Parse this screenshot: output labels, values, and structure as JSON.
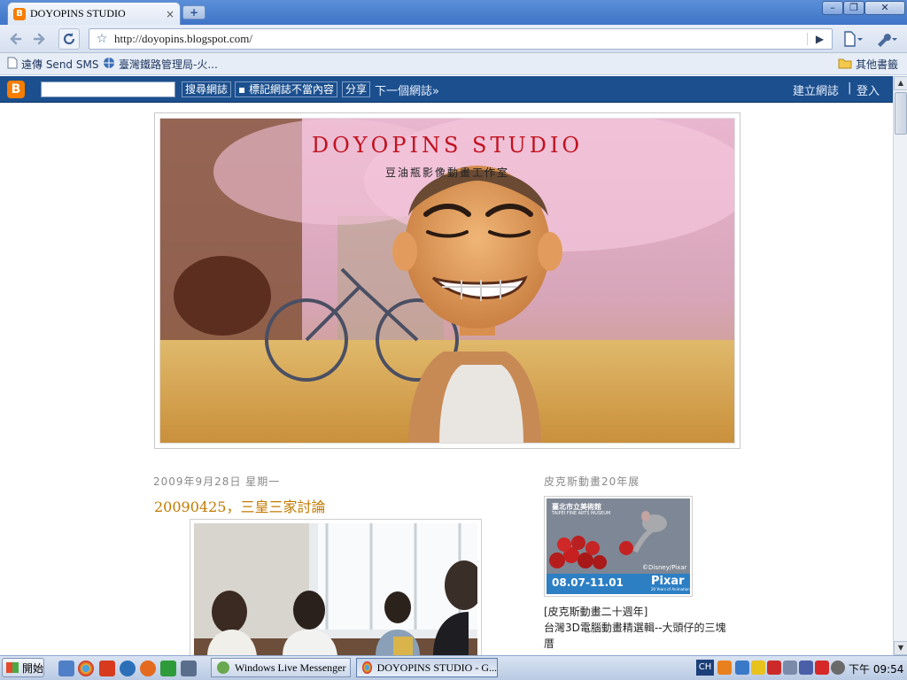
{
  "browser": {
    "tab_title": "DOYOPINS STUDIO",
    "tab_close": "×",
    "new_tab": "+",
    "url": "http://doyopins.blogspot.com/",
    "window_controls": {
      "minimize": "–",
      "restore": "❐",
      "close": "✕"
    }
  },
  "bookmarks": {
    "items": [
      {
        "label": "遠傳 Send SMS",
        "icon": "page-icon"
      },
      {
        "label": "臺灣鐵路管理局-火...",
        "icon": "globe-icon"
      }
    ],
    "other": "其他書籤"
  },
  "navbar": {
    "search_button": "搜尋網誌",
    "flag_button": "標記網誌不當內容",
    "share_button": "分享",
    "next_blog": "下一個網誌»",
    "create_blog": "建立網誌",
    "separator": "|",
    "login": "登入"
  },
  "blog": {
    "title": "DOYOPINS STUDIO",
    "subtitle": "豆油瓶影像動畫工作室",
    "post_date": "2009年9月28日 星期一",
    "post_title": "20090425，三皇三家討論"
  },
  "sidebar": {
    "section_title": "皮克斯動畫20年展",
    "caption": "[皮克斯動畫二十週年]",
    "description": "台灣3D電腦動畫精選輯--大頭仔的三塊厝",
    "poster": {
      "museum": "臺北市立美術館",
      "museum_en": "TAIPEI FINE ARTS MUSEUM",
      "dates": "08.07-11.01",
      "brand": "Pixar",
      "brand_tag": "20 Years of Animation",
      "credit": "©Disney/Pixar"
    }
  },
  "taskbar": {
    "start": "開始",
    "windows": [
      {
        "label": "Windows Live Messenger",
        "active": false
      },
      {
        "label": "DOYOPINS STUDIO - G...",
        "active": true
      }
    ],
    "tray_lang": "CH",
    "clock": "下午 09:54"
  },
  "colors": {
    "navbar_bg": "#1b4f8e",
    "blog_title": "#c1121f",
    "post_title": "#c27a00",
    "blogger_orange": "#f57d00"
  }
}
